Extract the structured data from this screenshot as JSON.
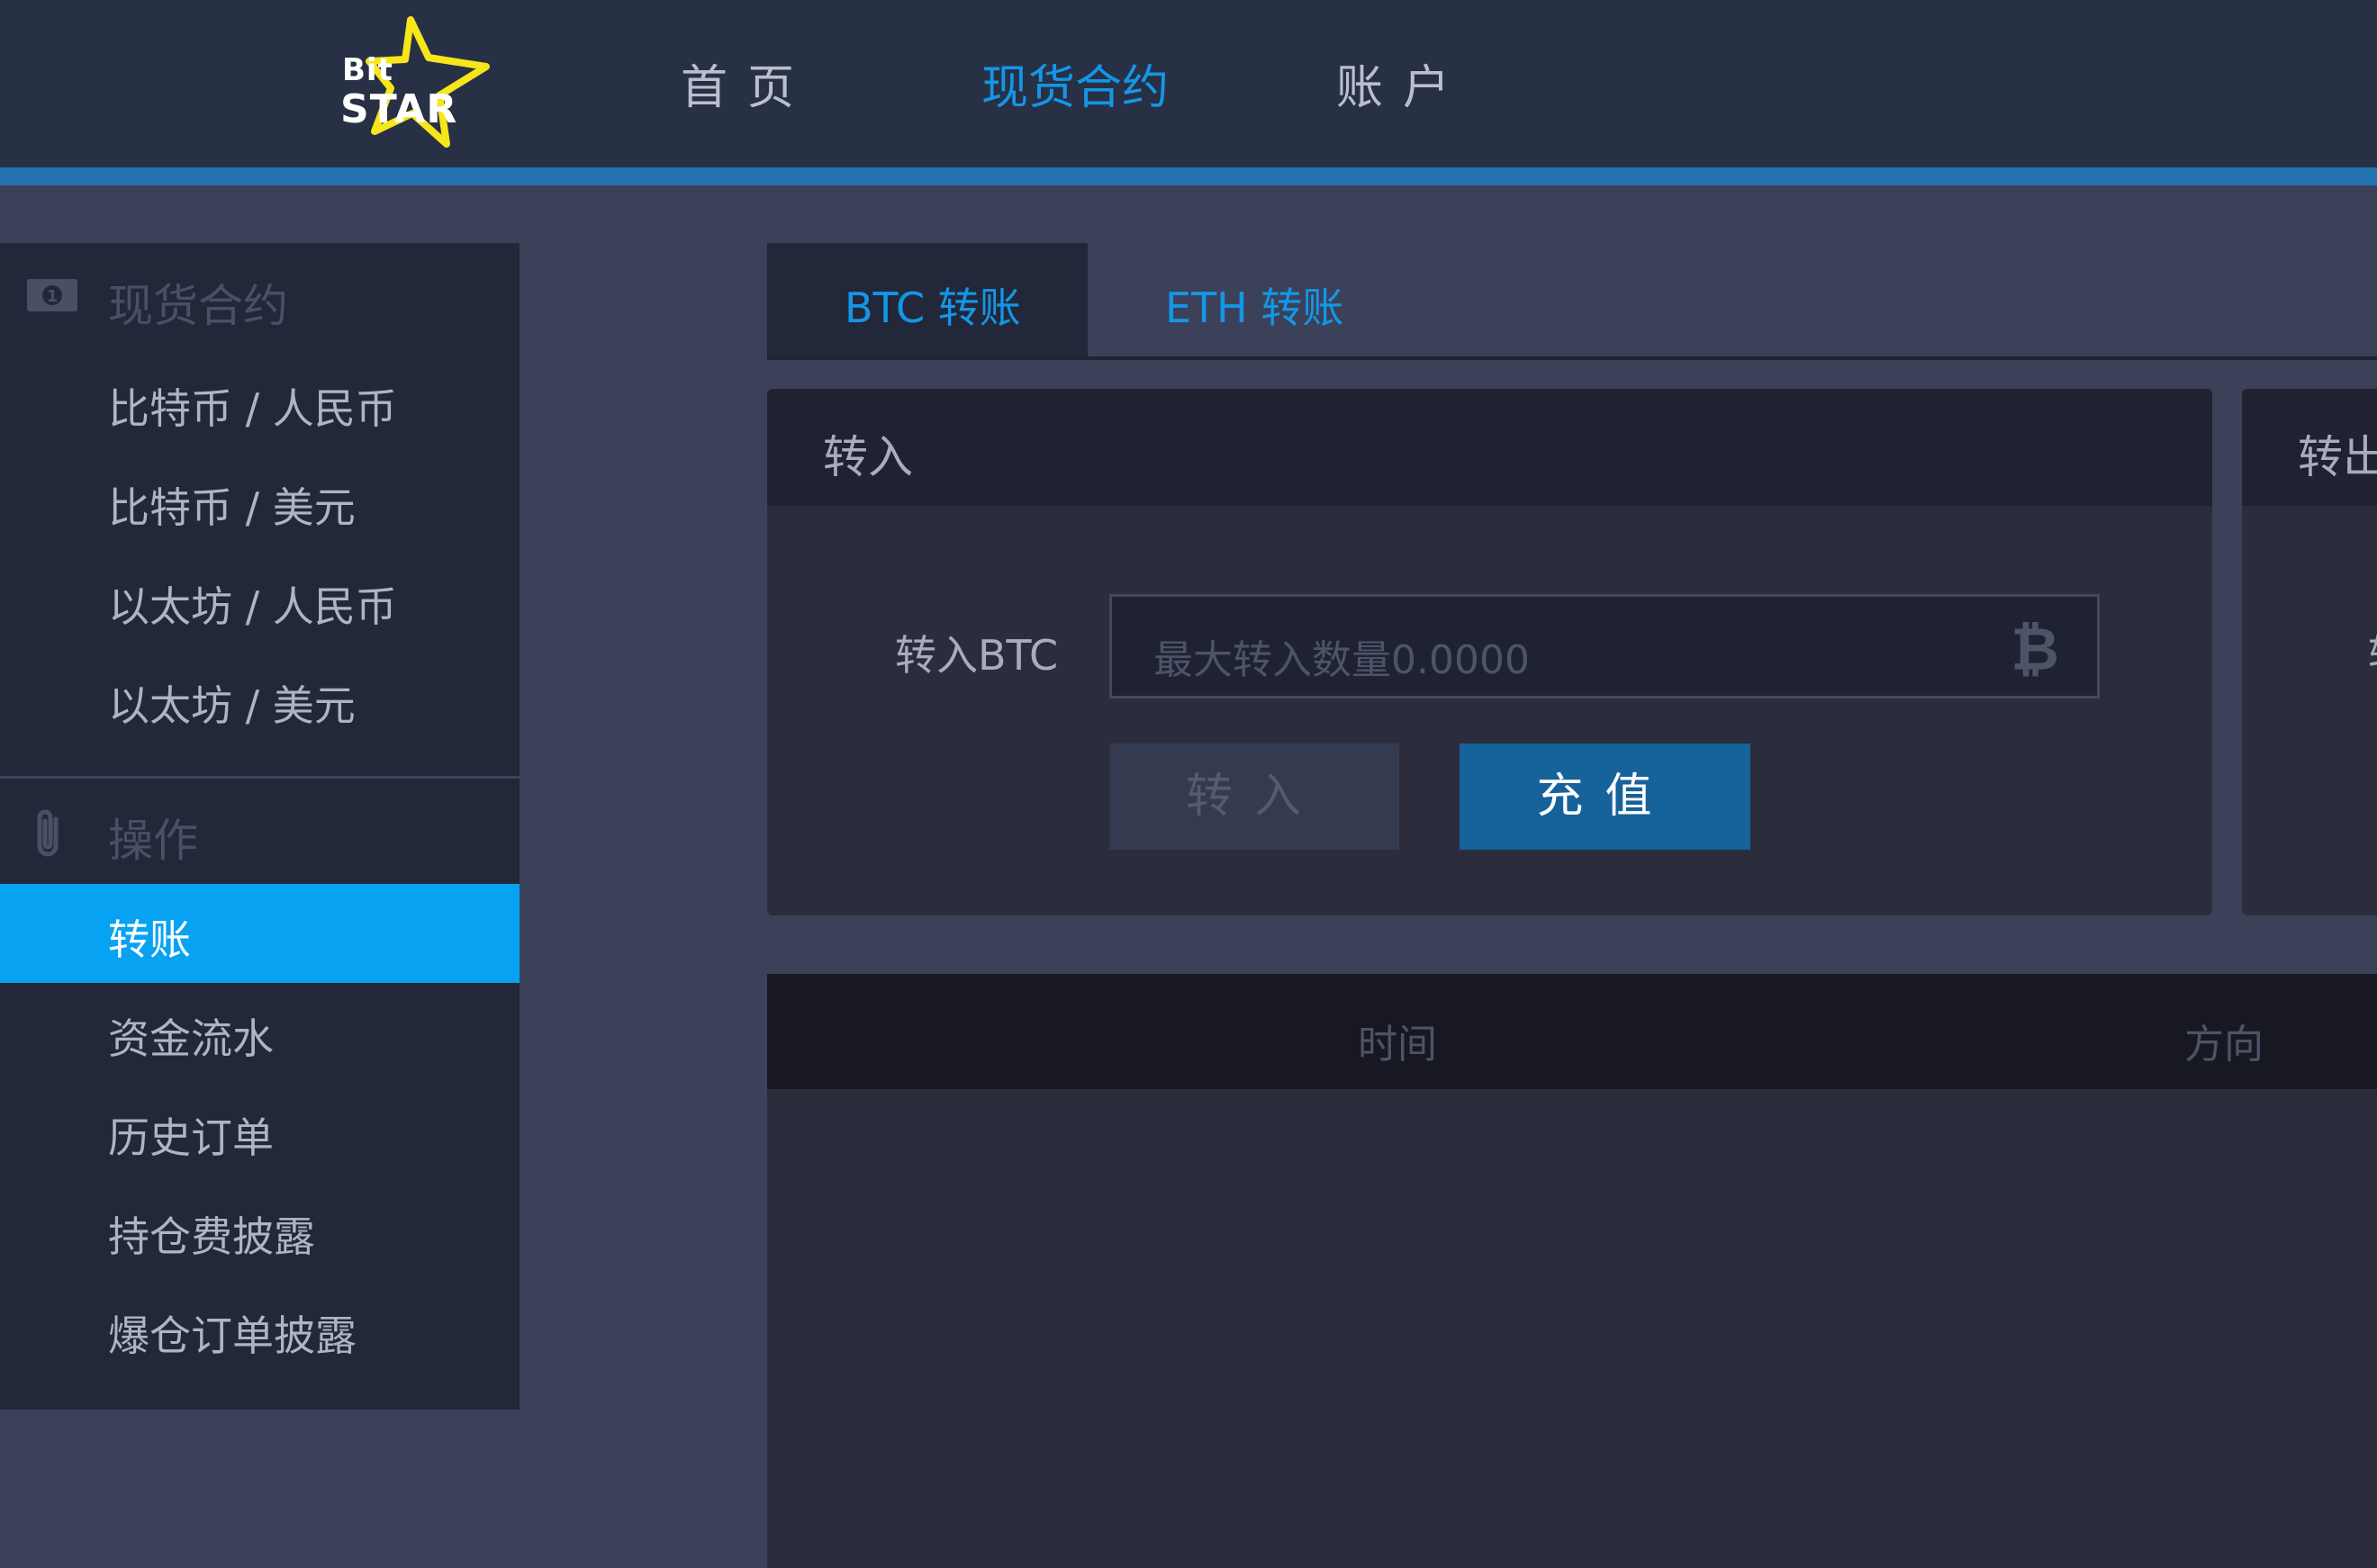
{
  "header": {
    "logo": {
      "line1": "Bit",
      "line2": "STAR"
    },
    "nav": [
      {
        "label": "首页",
        "active": false
      },
      {
        "label": "现货合约",
        "active": true
      },
      {
        "label": "账户",
        "active": false
      }
    ]
  },
  "sidebar": {
    "section1": {
      "icon": "money-icon",
      "title": "现货合约"
    },
    "markets": [
      {
        "label": "比特币 / 人民币"
      },
      {
        "label": "比特币 / 美元"
      },
      {
        "label": "以太坊 / 人民币"
      },
      {
        "label": "以太坊 / 美元"
      }
    ],
    "section2": {
      "icon": "paperclip-icon",
      "title": "操作"
    },
    "operations": [
      {
        "label": "转账",
        "active": true
      },
      {
        "label": "资金流水",
        "active": false
      },
      {
        "label": "历史订单",
        "active": false
      },
      {
        "label": "持仓费披露",
        "active": false
      },
      {
        "label": "爆仓订单披露",
        "active": false
      }
    ]
  },
  "tabs": [
    {
      "label": "BTC 转账",
      "active": true
    },
    {
      "label": "ETH 转账",
      "active": false
    }
  ],
  "transfer_in": {
    "title": "转入",
    "field_label": "转入BTC",
    "placeholder": "最大转入数量0.0000",
    "currency_icon": "bitcoin-icon",
    "currency_glyph": "₿",
    "transfer_button": "转入",
    "deposit_button": "充值"
  },
  "transfer_out": {
    "title": "转出",
    "field_label_fragment": "转"
  },
  "table": {
    "columns": [
      "时间",
      "方向"
    ]
  },
  "colors": {
    "background": "#3a4159",
    "header": "#283046",
    "accent": "#1496e6",
    "active_item": "#07a2f2",
    "primary_button": "#16629b",
    "logo_star": "#f6e61a"
  }
}
